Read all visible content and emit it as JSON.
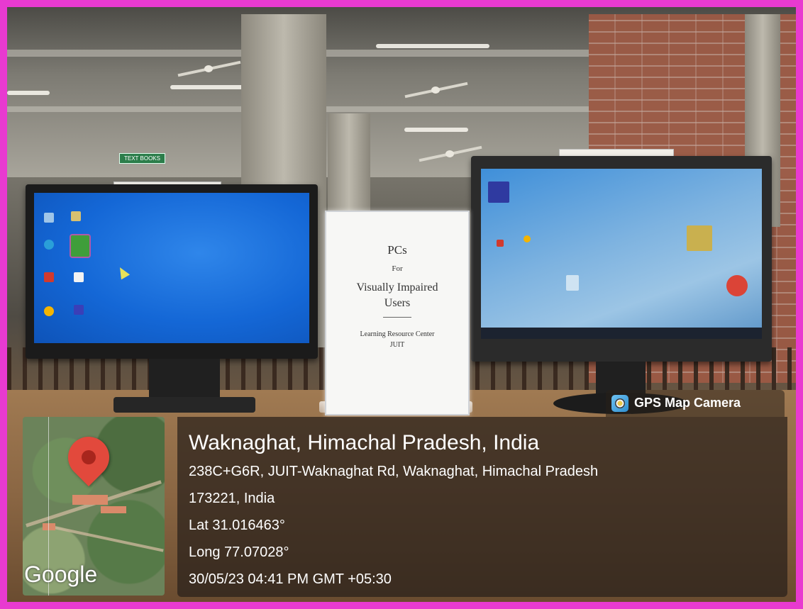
{
  "tent_card": {
    "line1": "PCs",
    "line2": "For",
    "line3": "Visually Impaired",
    "line4": "Users",
    "line5": "Learning Resource Center",
    "line6": "JUIT"
  },
  "wall_sign": "TEXT BOOKS",
  "gps": {
    "app_name": "GPS Map Camera",
    "place_title": "Waknaghat, Himachal Pradesh, India",
    "address_line1": "238C+G6R, JUIT-Waknaghat Rd, Waknaghat, Himachal Pradesh",
    "address_line2": "173221, India",
    "latitude": "Lat 31.016463°",
    "longitude": "Long 77.07028°",
    "timestamp": "30/05/23 04:41 PM GMT +05:30",
    "map_provider": "Google",
    "pin_icon": "map-pin-icon",
    "accent_color": "#e2493c"
  },
  "colors": {
    "frame": "#e83ad0",
    "overlay": "#28201a"
  }
}
